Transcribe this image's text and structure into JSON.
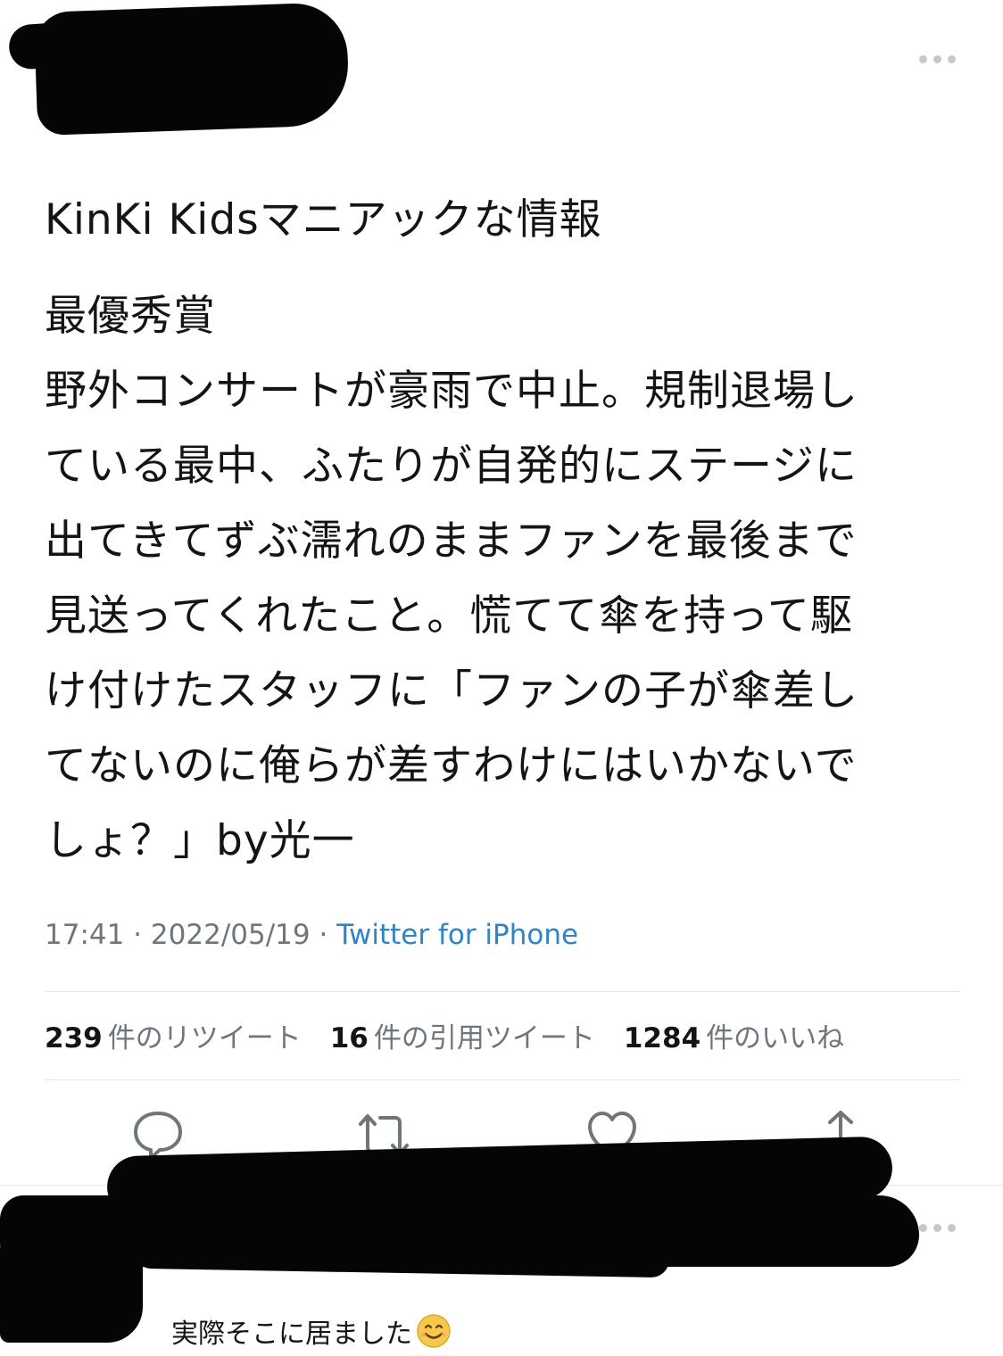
{
  "tweet": {
    "lines": [
      "KinKi Kidsマニアックな情報",
      "最優秀賞",
      "野外コンサートが豪雨で中止。規制退場し",
      "ている最中、ふたりが自発的にステージに",
      "出てきてずぶ濡れのままファンを最後まで",
      "見送ってくれたこと。慌てて傘を持って駆",
      "け付けたスタッフに「ファンの子が傘差し",
      "てないのに俺らが差すわけにはいかないで",
      "しょ？」by光一"
    ],
    "time": "17:41",
    "date": "2022/05/19",
    "separator": "·",
    "source": "Twitter for iPhone"
  },
  "stats": {
    "retweets": {
      "count": "239",
      "label": "件のリツイート"
    },
    "quotes": {
      "count": "16",
      "label": "件の引用ツイート"
    },
    "likes": {
      "count": "1284",
      "label": "件のいいね"
    }
  },
  "actions": {
    "icons": [
      "reply-icon",
      "retweet-icon",
      "like-icon",
      "share-icon"
    ],
    "icon_color": "#6e767d"
  },
  "reply": {
    "text": "実際そこに居ました",
    "emoji": "smiling-face-emoji"
  },
  "colors": {
    "link": "#2f83c8",
    "muted": "#6e767d",
    "redaction": "#050505"
  }
}
